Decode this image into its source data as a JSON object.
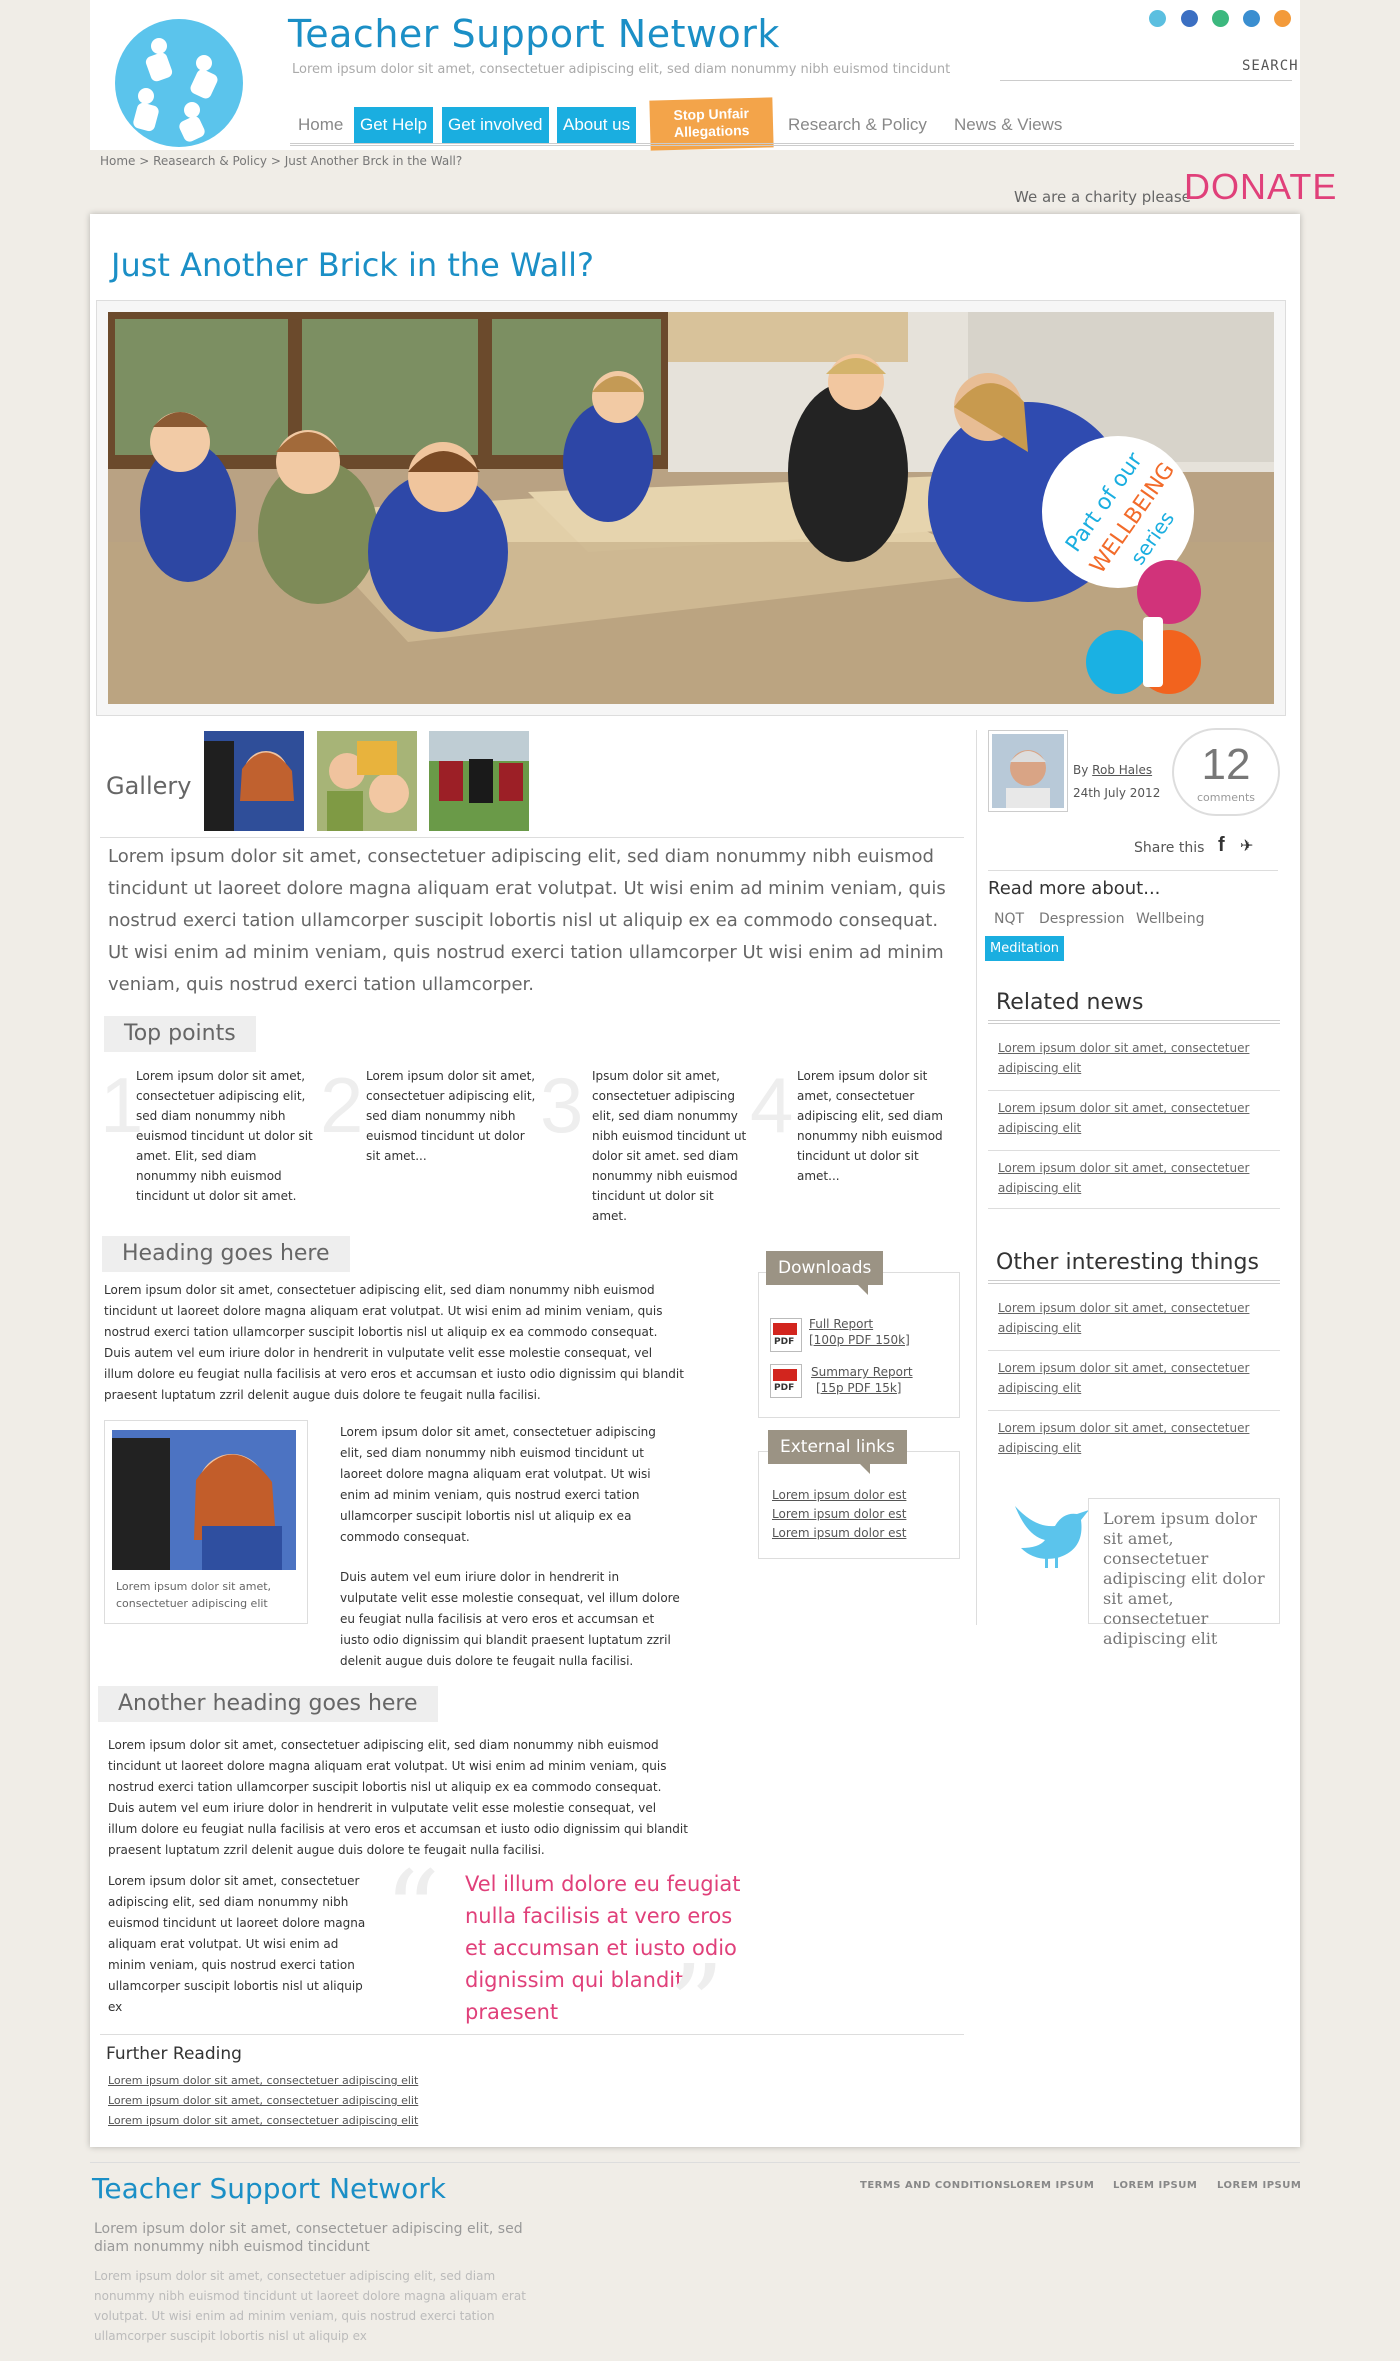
{
  "header": {
    "site_title": "Teacher Support Network",
    "tagline": "Lorem ipsum dolor sit amet, consectetuer adipiscing elit, sed diam nonummy nibh euismod tincidunt",
    "search_label": "SEARCH",
    "social_icons": [
      "twitter-icon",
      "facebook-icon",
      "vine-icon",
      "linkedin-icon",
      "rss-icon"
    ]
  },
  "nav": {
    "home": "Home",
    "get_help": "Get Help",
    "get_involved": "Get involved",
    "about_us": "About us",
    "stop_line1": "Stop Unfair",
    "stop_line2": "Allegations",
    "research": "Research & Policy",
    "news": "News & Views"
  },
  "breadcrumb": "Home > Reasearch & Policy > Just Another Brck in the Wall?",
  "donate": {
    "charity_text": "We are a charity please",
    "button": "DONATE"
  },
  "article": {
    "title": "Just Another Brick in the Wall?",
    "badge_line1": "Part of our",
    "badge_line2": "WELLBEING",
    "badge_line3": "series",
    "gallery_label": "Gallery",
    "intro": "Lorem ipsum dolor sit amet, consectetuer adipiscing elit, sed diam nonummy nibh euismod tincidunt ut laoreet dolore magna aliquam erat volutpat. Ut wisi enim ad minim veniam, quis nostrud exerci tation ullamcorper suscipit lobortis nisl ut aliquip ex ea commodo consequat. Ut wisi enim ad minim veniam, quis nostrud exerci tation ullamcorper Ut wisi enim ad minim veniam, quis nostrud exerci tation ullamcorper.",
    "top_points_heading": "Top points",
    "top_points": [
      {
        "num": "1",
        "text": "Lorem ipsum dolor sit amet, consectetuer adipiscing elit, sed diam nonummy nibh euismod tincidunt ut dolor sit amet. Elit, sed diam nonummy nibh euismod tincidunt ut dolor sit amet."
      },
      {
        "num": "2",
        "text": "Lorem ipsum dolor sit amet, consectetuer adipiscing elit, sed diam nonummy nibh euismod tincidunt ut dolor sit amet..."
      },
      {
        "num": "3",
        "text": "Ipsum dolor sit amet, consectetuer adipiscing elit, sed diam nonummy nibh euismod tincidunt ut dolor sit amet. sed diam nonummy nibh euismod tincidunt ut dolor sit amet."
      },
      {
        "num": "4",
        "text": "Lorem ipsum dolor sit amet, consectetuer adipiscing elit, sed diam nonummy nibh euismod tincidunt ut dolor sit amet..."
      }
    ],
    "heading2": "Heading goes here",
    "para2": "Lorem ipsum dolor sit amet, consectetuer adipiscing elit, sed diam nonummy nibh euismod tincidunt ut laoreet dolore magna aliquam erat volutpat. Ut wisi enim ad minim veniam, quis nostrud exerci tation ullamcorper suscipit lobortis nisl ut aliquip ex ea commodo consequat. Duis autem vel eum iriure dolor in hendrerit in vulputate velit esse molestie consequat, vel illum dolore eu feugiat nulla facilisis at vero eros et accumsan et iusto odio dignissim qui blandit praesent luptatum zzril delenit augue duis dolore te feugait nulla facilisi.",
    "image_caption": "Lorem ipsum dolor sit amet, consectetuer adipiscing elit",
    "para3a": "Lorem ipsum dolor sit amet, consectetuer adipiscing elit, sed diam nonummy nibh euismod tincidunt ut laoreet dolore magna aliquam erat volutpat. Ut wisi enim ad minim veniam, quis nostrud exerci tation ullamcorper suscipit lobortis nisl ut aliquip ex ea commodo consequat.",
    "para3b": "Duis autem vel eum iriure dolor in hendrerit in vulputate velit esse molestie consequat, vel illum dolore eu feugiat nulla facilisis at vero eros et accumsan et iusto odio dignissim qui blandit praesent luptatum zzril delenit augue duis dolore te feugait nulla facilisi.",
    "heading3": "Another heading goes here",
    "para4": "Lorem ipsum dolor sit amet, consectetuer adipiscing elit, sed diam nonummy nibh euismod tincidunt ut laoreet dolore magna aliquam erat volutpat. Ut wisi enim ad minim veniam, quis nostrud exerci tation ullamcorper suscipit lobortis nisl ut aliquip ex ea commodo consequat. Duis autem vel eum iriure dolor in hendrerit in vulputate velit esse molestie consequat, vel illum dolore eu feugiat nulla facilisis at vero eros et accumsan et iusto odio dignissim qui blandit praesent luptatum zzril delenit augue duis dolore te feugait nulla facilisi.",
    "para5": "Lorem ipsum dolor sit amet, consectetuer adipiscing elit, sed diam nonummy nibh euismod tincidunt ut laoreet dolore magna aliquam erat volutpat. Ut wisi enim ad minim veniam, quis nostrud exerci tation ullamcorper suscipit lobortis nisl ut aliquip ex",
    "pull_quote": "Vel illum dolore eu feugiat nulla facilisis at vero eros et accumsan et iusto odio dignissim qui blandit praesent",
    "further_reading_heading": "Further Reading",
    "further_reading": [
      "Lorem ipsum dolor sit amet, consectetuer adipiscing elit",
      "Lorem ipsum dolor sit amet, consectetuer adipiscing elit",
      "Lorem ipsum dolor sit amet, consectetuer adipiscing elit"
    ]
  },
  "downloads": {
    "heading": "Downloads",
    "items": [
      {
        "line1": "Full Report",
        "line2": "[100p PDF 150k]"
      },
      {
        "line1": "Summary Report",
        "line2": "[15p PDF 15k]"
      }
    ]
  },
  "external_links": {
    "heading": "External links",
    "items": [
      "Lorem ipsum dolor est",
      "Lorem ipsum dolor est",
      "Lorem ipsum dolor est"
    ]
  },
  "sidebar": {
    "by_label": "By",
    "author": "Rob Hales",
    "date": "24th July 2012",
    "comment_count": "12",
    "comments_label": "comments",
    "share_label": "Share this",
    "read_more_heading": "Read more about...",
    "tags": [
      "NQT",
      "Despression",
      "Wellbeing",
      "Meditation"
    ],
    "related_heading": "Related news",
    "related": [
      "Lorem ipsum dolor sit amet, consectetuer adipiscing elit",
      "Lorem ipsum dolor sit amet, consectetuer adipiscing elit",
      "Lorem ipsum dolor sit amet, consectetuer adipiscing elit"
    ],
    "other_heading": "Other interesting things",
    "other": [
      "Lorem ipsum dolor sit amet, consectetuer adipiscing elit",
      "Lorem ipsum dolor sit amet, consectetuer adipiscing elit",
      "Lorem ipsum dolor sit amet, consectetuer adipiscing elit"
    ],
    "tweet": "Lorem ipsum dolor sit amet, consectetuer adipiscing elit dolor sit amet, consectetuer adipiscing elit"
  },
  "footer": {
    "title": "Teacher Support Network",
    "subtitle": "Lorem ipsum dolor sit amet, consectetuer adipiscing elit, sed diam nonummy nibh euismod tincidunt",
    "text": "Lorem ipsum dolor sit amet, consectetuer adipiscing elit, sed diam nonummy nibh euismod tincidunt ut laoreet dolore magna aliquam erat volutpat. Ut wisi enim ad minim veniam, quis nostrud exerci tation ullamcorper suscipit lobortis nisl ut aliquip ex",
    "links": [
      "TERMS AND CONDITIONS",
      "LOREM IPSUM",
      "LOREM IPSUM",
      "LOREM IPSUM"
    ]
  },
  "colors": {
    "brand_blue": "#1b8fc6",
    "nav_blue": "#1aaee0",
    "orange": "#f3a44a",
    "pink": "#e0407a"
  }
}
